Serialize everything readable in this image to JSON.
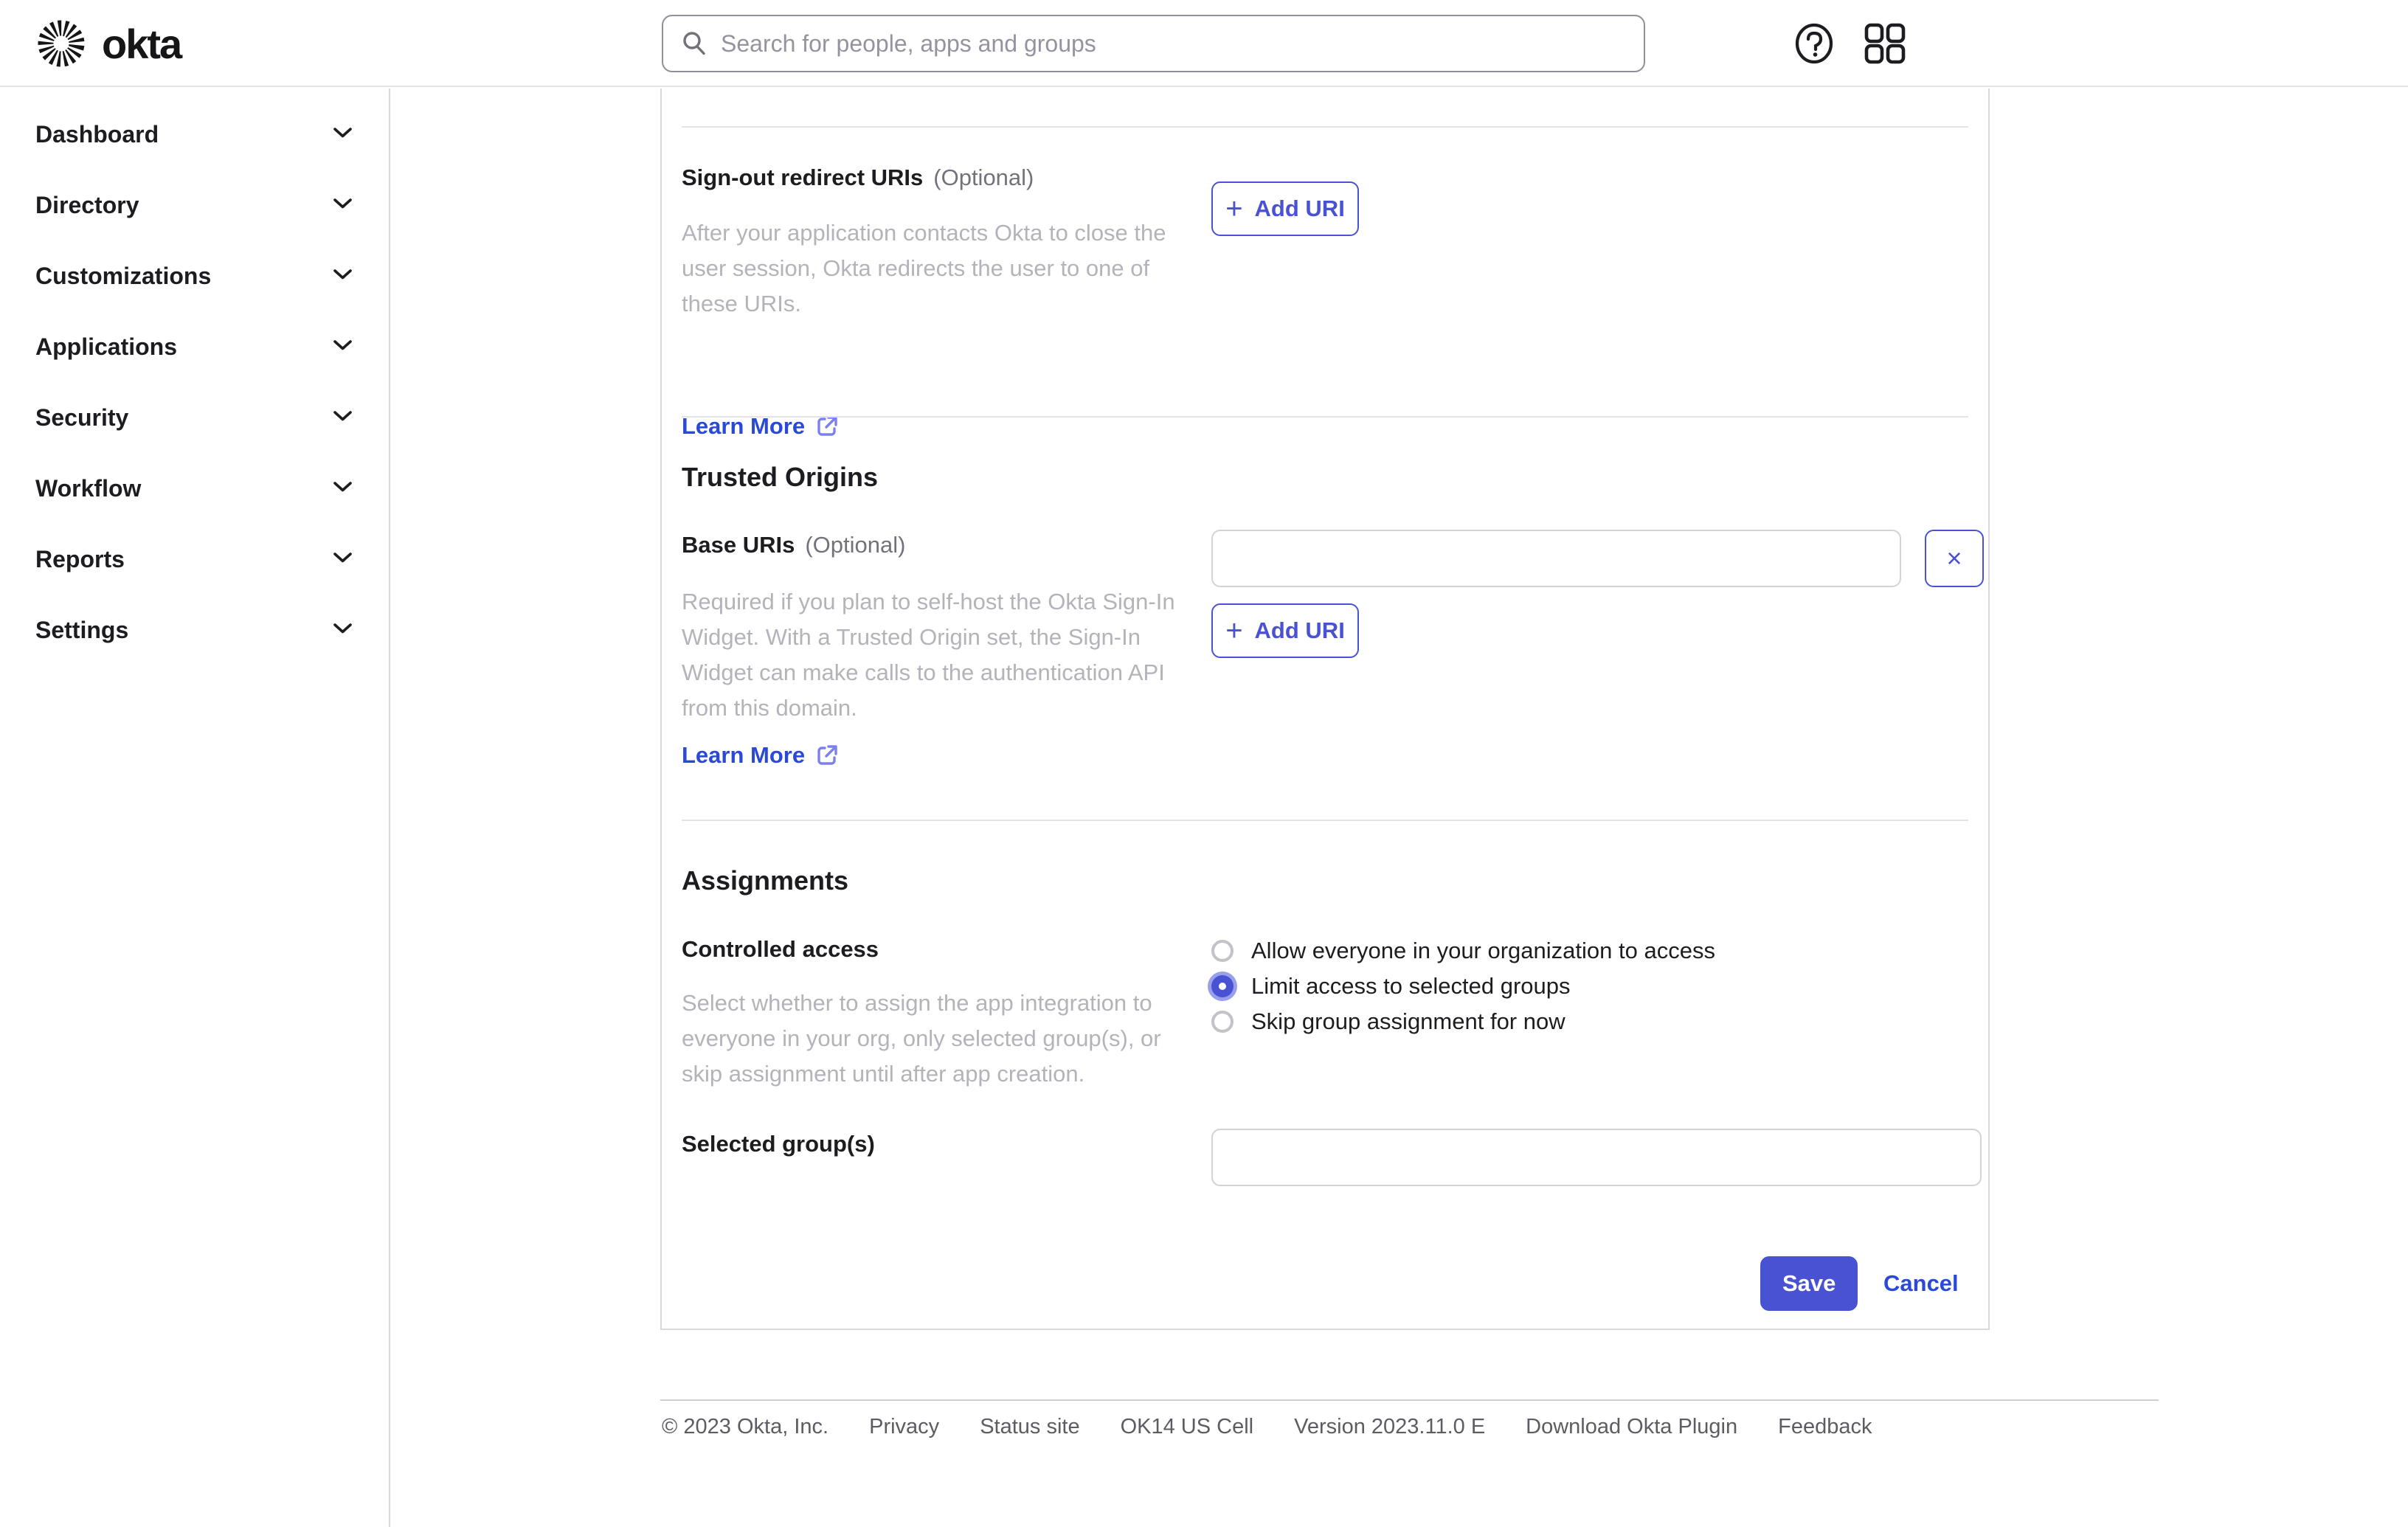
{
  "topbar": {
    "brand": "okta",
    "search": {
      "placeholder": "Search for people, apps and groups",
      "value": ""
    }
  },
  "sidebar": {
    "items": [
      {
        "label": "Dashboard"
      },
      {
        "label": "Directory"
      },
      {
        "label": "Customizations"
      },
      {
        "label": "Applications"
      },
      {
        "label": "Security"
      },
      {
        "label": "Workflow"
      },
      {
        "label": "Reports"
      },
      {
        "label": "Settings"
      }
    ]
  },
  "form": {
    "signout": {
      "label": "Sign-out redirect URIs",
      "optional": "(Optional)",
      "description_lines": [
        "After your application contacts Okta to close the",
        "user session, Okta redirects the user to one of",
        "these URIs."
      ],
      "learn_more": "Learn More",
      "add_uri": "Add URI"
    },
    "trusted_origins": {
      "heading": "Trusted Origins",
      "label": "Base URIs",
      "optional": "(Optional)",
      "input_value": "",
      "clear_symbol": "×",
      "add_uri": "Add URI",
      "description_lines": [
        "Required if you plan to self-host the Okta Sign-In",
        "Widget. With a Trusted Origin set, the Sign-In",
        "Widget can make calls to the authentication API",
        "from this domain."
      ],
      "learn_more": "Learn More"
    },
    "assignments": {
      "heading": "Assignments",
      "label": "Controlled access",
      "description_lines": [
        "Select whether to assign the app integration to",
        "everyone in your org, only selected group(s), or",
        "skip assignment until after app creation."
      ],
      "options": [
        {
          "label": "Allow everyone in your organization to access",
          "selected": false
        },
        {
          "label": "Limit access to selected groups",
          "selected": true
        },
        {
          "label": "Skip group assignment for now",
          "selected": false
        }
      ],
      "selected_groups_label": "Selected group(s)",
      "selected_groups_value": ""
    },
    "actions": {
      "save": "Save",
      "cancel": "Cancel"
    }
  },
  "footer": {
    "items": [
      "© 2023 Okta, Inc.",
      "Privacy",
      "Status site",
      "OK14 US Cell",
      "Version 2023.11.0 E",
      "Download Okta Plugin",
      "Feedback"
    ]
  },
  "colors": {
    "accent": "#4a52d4",
    "link": "#2b49d7",
    "link_icon": "#7b80ee",
    "text": "#1d1d21",
    "muted": "#b3b3bb",
    "optional": "#72727c",
    "footer_text": "#5c5c64"
  }
}
